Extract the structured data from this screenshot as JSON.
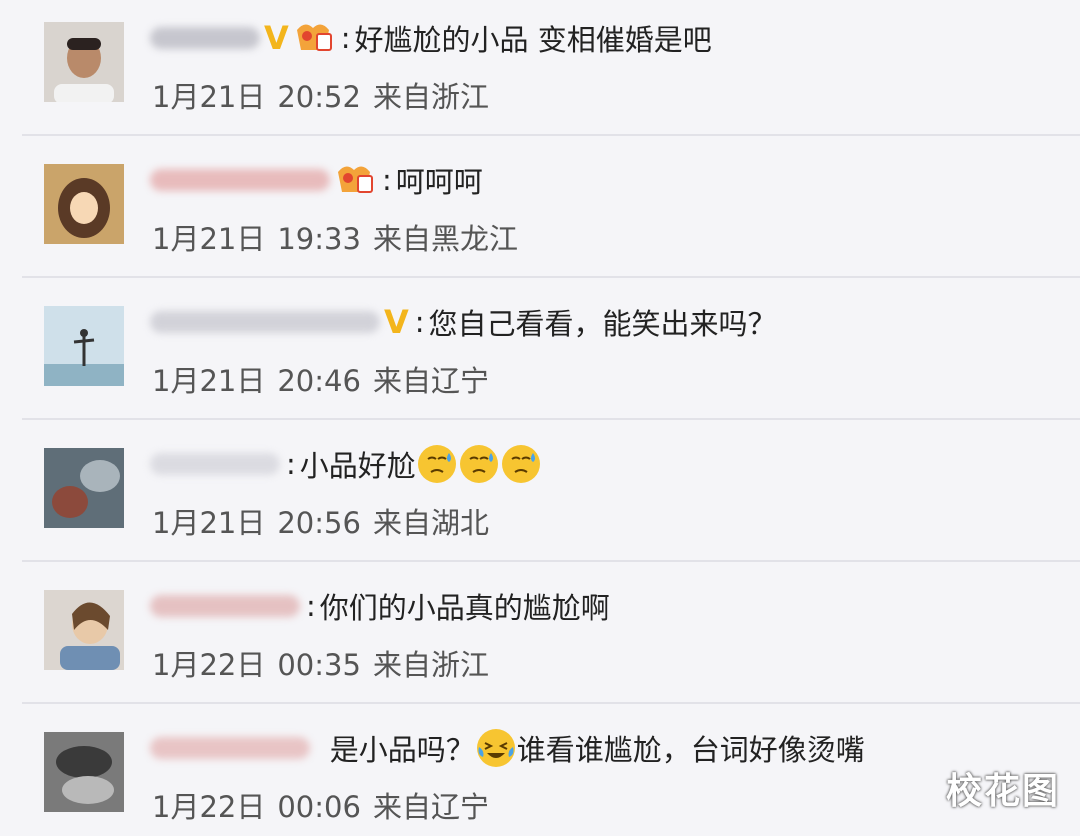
{
  "comments": [
    {
      "text": "好尴尬的小品 变相催婚是吧",
      "date": "1月21日",
      "time": "20:52",
      "location": "来自浙江",
      "badges": [
        "verified-v-icon",
        "level-badge-icon"
      ],
      "emojis": []
    },
    {
      "text": "呵呵呵",
      "date": "1月21日",
      "time": "19:33",
      "location": "来自黑龙江",
      "badges": [
        "level-badge-icon"
      ],
      "emojis": []
    },
    {
      "text": "您自己看看，能笑出来吗？",
      "date": "1月21日",
      "time": "20:46",
      "location": "来自辽宁",
      "badges": [
        "verified-v-icon"
      ],
      "emojis": []
    },
    {
      "text": "小品好尬",
      "date": "1月21日",
      "time": "20:56",
      "location": "来自湖北",
      "badges": [],
      "emojis": [
        "sweat-face-icon",
        "sweat-face-icon",
        "sweat-face-icon"
      ]
    },
    {
      "text": "你们的小品真的尴尬啊",
      "date": "1月22日",
      "time": "00:35",
      "location": "来自浙江",
      "badges": [],
      "emojis": []
    },
    {
      "text_before": "是小品吗？",
      "text_after": "谁看谁尴尬，台词好像烫嘴",
      "date": "1月22日",
      "time": "00:06",
      "location": "来自辽宁",
      "badges": [],
      "emojis": [
        "crying-laughing-face-icon"
      ]
    }
  ],
  "colon": ":",
  "watermark": "校花图",
  "colors": {
    "background": "#f5f5f8",
    "text": "#222222",
    "meta": "#555555",
    "verified": "#f3b51c",
    "emoji": "#f7c531"
  }
}
